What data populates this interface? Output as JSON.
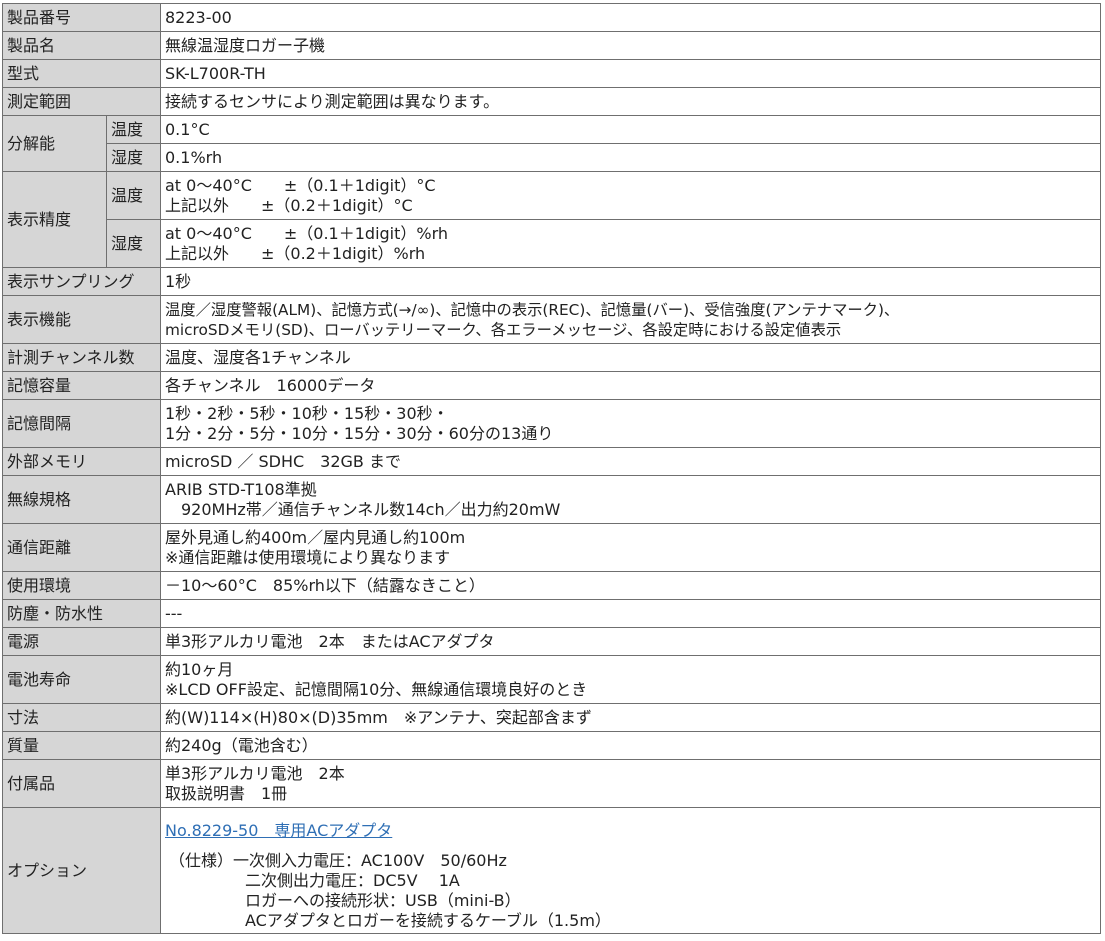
{
  "rows": {
    "product_no": {
      "label": "製品番号",
      "value": "8223-00"
    },
    "product_name": {
      "label": "製品名",
      "value": "無線温湿度ロガー子機"
    },
    "model": {
      "label": "型式",
      "value": "SK-L700R-TH"
    },
    "range": {
      "label": "測定範囲",
      "value": "接続するセンサにより測定範囲は異なります。"
    },
    "resolution": {
      "label": "分解能",
      "temp": {
        "label": "温度",
        "value": "0.1°C"
      },
      "hum": {
        "label": "湿度",
        "value": "0.1%rh"
      }
    },
    "accuracy": {
      "label": "表示精度",
      "temp": {
        "label": "温度",
        "value": "at 0～40°C　　±（0.1＋1digit）°C\n上記以外　　±（0.2＋1digit）°C"
      },
      "hum": {
        "label": "湿度",
        "value": "at 0～40°C　　±（0.1＋1digit）%rh\n上記以外　　±（0.2＋1digit）%rh"
      }
    },
    "sampling": {
      "label": "表示サンプリング",
      "value": "1秒"
    },
    "display": {
      "label": "表示機能",
      "value": "温度／湿度警報(ALM)、記憶方式(→/∞)、記憶中の表示(REC)、記憶量(バー)、受信強度(アンテナマーク)、\nmicroSDメモリ(SD)、ローバッテリーマーク、各エラーメッセージ、各設定時における設定値表示"
    },
    "channels": {
      "label": "計測チャンネル数",
      "value": "温度、湿度各1チャンネル"
    },
    "capacity": {
      "label": "記憶容量",
      "value": "各チャンネル　16000データ"
    },
    "interval": {
      "label": "記憶間隔",
      "value": "1秒・2秒・5秒・10秒・15秒・30秒・\n1分・2分・5分・10分・15分・30分・60分の13通り"
    },
    "ext_memory": {
      "label": "外部メモリ",
      "value": "microSD ／ SDHC　32GB まで"
    },
    "wireless": {
      "label": "無線規格",
      "value": "ARIB STD-T108準拠\n　920MHz帯／通信チャンネル数14ch／出力約20mW"
    },
    "distance": {
      "label": "通信距離",
      "value": "屋外見通し約400m／屋内見通し約100m\n※通信距離は使用環境により異なります"
    },
    "environment": {
      "label": "使用環境",
      "value": "－10～60°C　85%rh以下（結露なきこと）"
    },
    "dustproof": {
      "label": "防塵・防水性",
      "value": "---"
    },
    "power": {
      "label": "電源",
      "value": "単3形アルカリ電池　2本　またはACアダプタ"
    },
    "battery_life": {
      "label": "電池寿命",
      "value": "約10ヶ月\n※LCD OFF設定、記憶間隔10分、無線通信環境良好のとき"
    },
    "dimensions": {
      "label": "寸法",
      "value": "約(W)114×(H)80×(D)35mm　※アンテナ、突起部含まず"
    },
    "mass": {
      "label": "質量",
      "value": "約240g（電池含む）"
    },
    "accessories": {
      "label": "付属品",
      "value": "単3形アルカリ電池　2本\n取扱説明書　1冊"
    },
    "option": {
      "label": "オプション",
      "link": "No.8229-50　専用ACアダプタ",
      "spec_prefix": "（仕様）",
      "spec_line1": "一次側入力電圧：AC100V　50/60Hz",
      "spec_line2": "二次側出力電圧：DC5V　 1A",
      "spec_line3": "ロガーへの接続形状：USB（mini-B）",
      "spec_line4": "ACアダプタとロガーを接続するケーブル（1.5m）"
    }
  }
}
